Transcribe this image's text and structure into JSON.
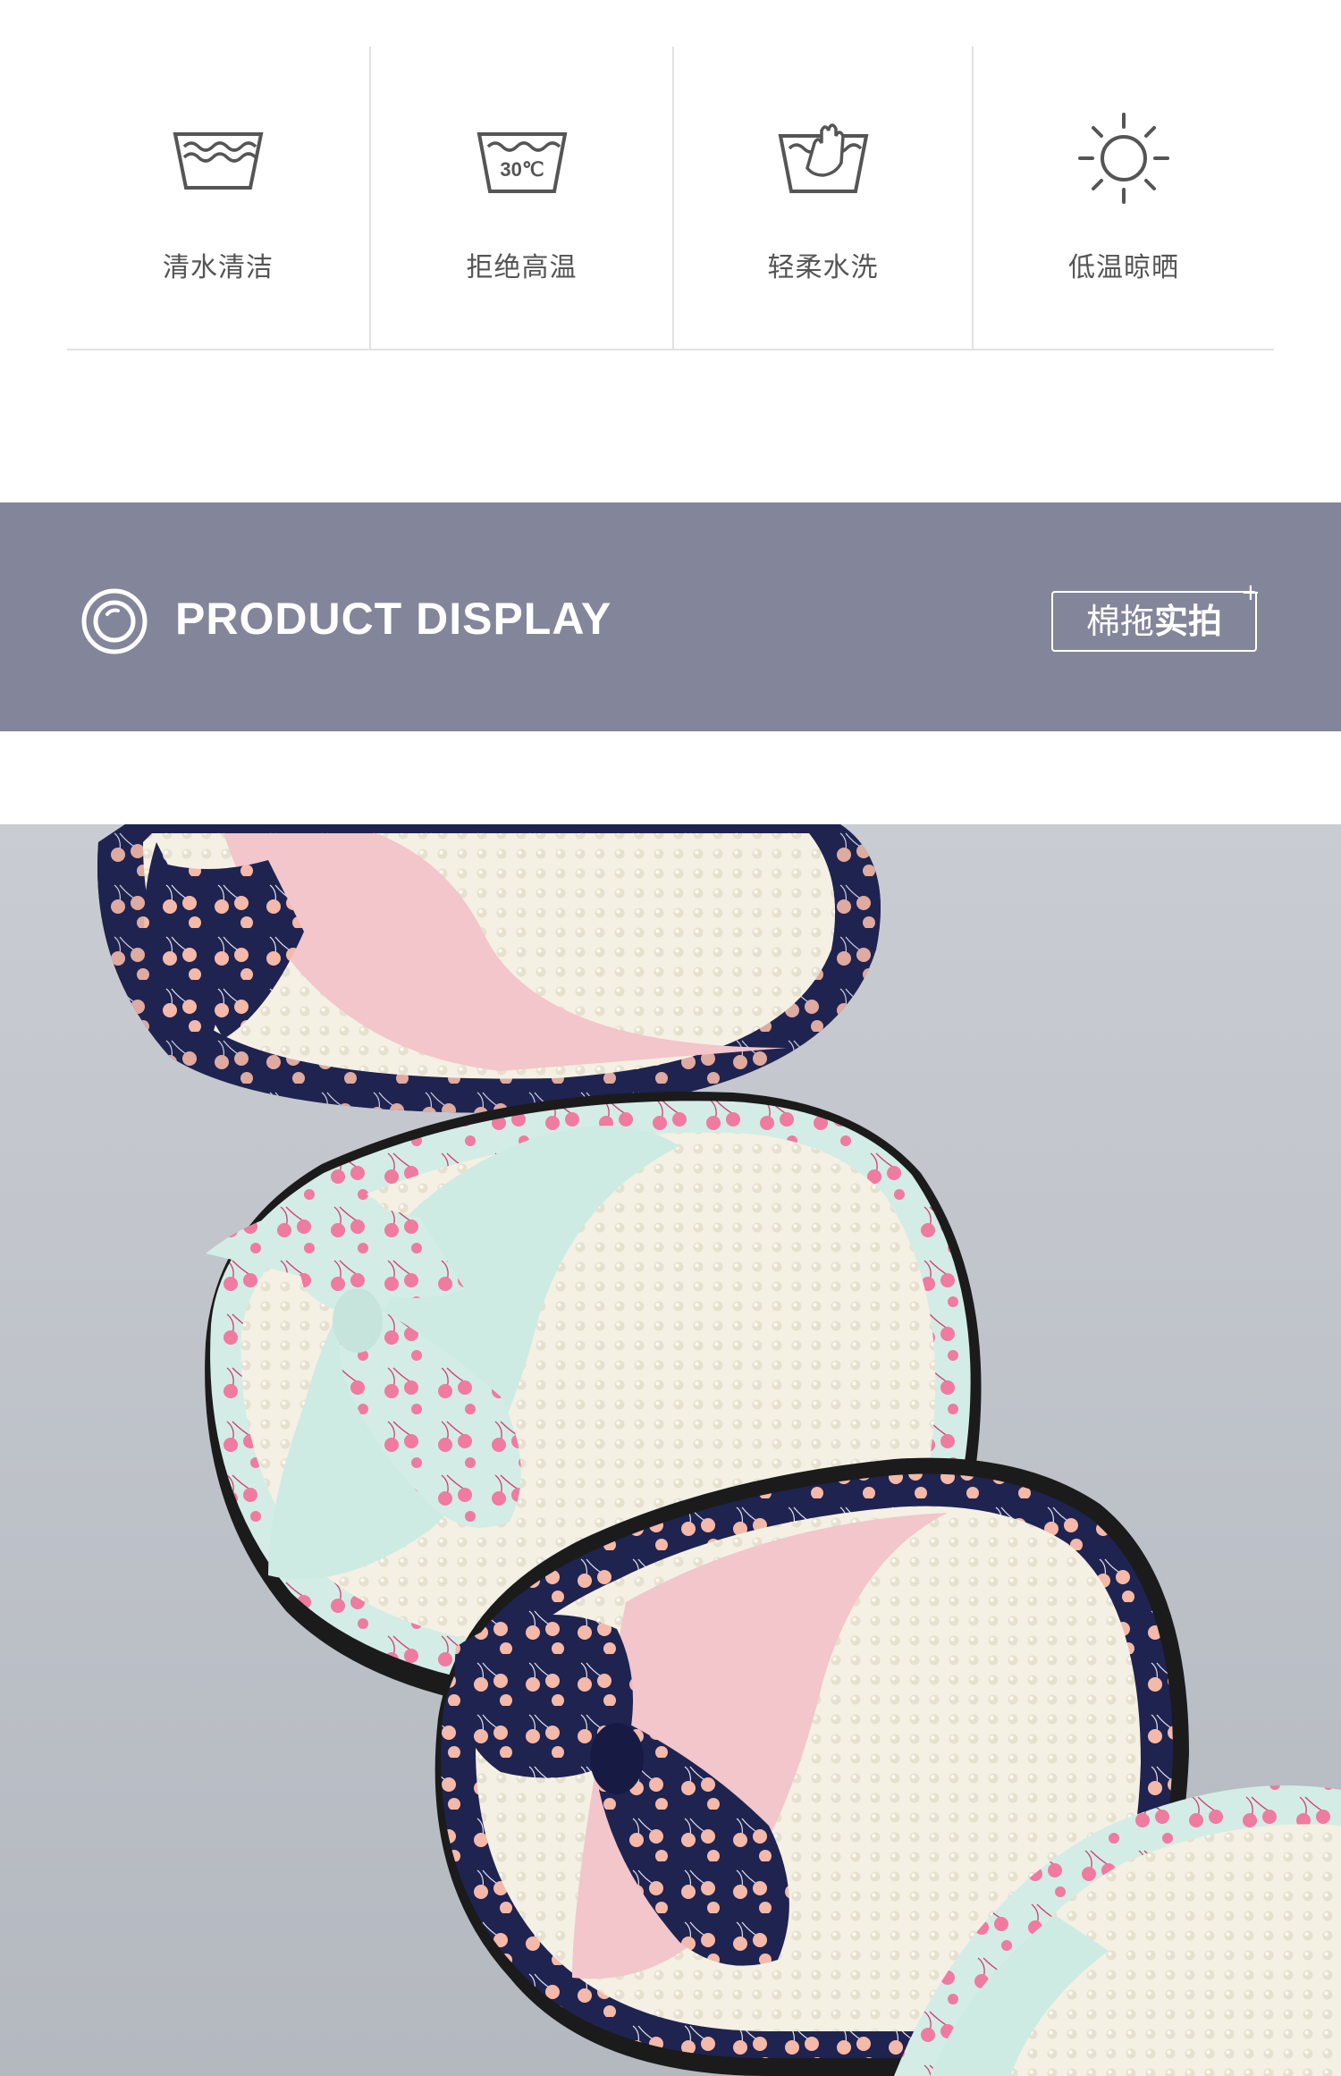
{
  "care": {
    "items": [
      {
        "label": "清水清洁",
        "icon": "wash-water-icon"
      },
      {
        "label": "拒绝高温",
        "icon": "wash-30c-icon",
        "icon_text": "30℃"
      },
      {
        "label": "轻柔水洗",
        "icon": "hand-wash-icon"
      },
      {
        "label": "低温晾晒",
        "icon": "sun-dry-icon"
      }
    ]
  },
  "banner": {
    "title": "PRODUCT DISPLAY",
    "tag_regular": "棉拖",
    "tag_bold": "实拍",
    "tag_plus": "+",
    "color": "#83869a"
  },
  "photo": {
    "subject": "cherry-print bow cotton slippers",
    "colors": {
      "navy": "#1f2350",
      "pink": "#f2c6cb",
      "mint": "#cdebe3",
      "cherry": "#f07aa0",
      "peach": "#f4b9a8",
      "insole": "#f3efe3"
    }
  }
}
